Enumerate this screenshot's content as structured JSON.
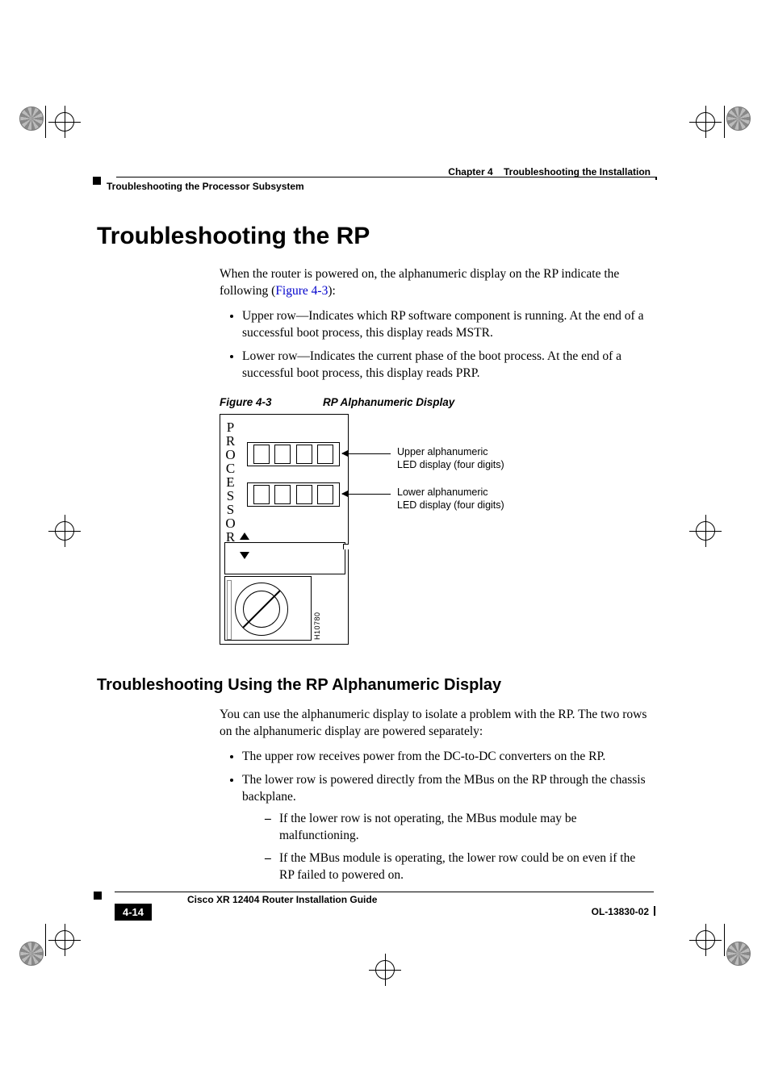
{
  "header": {
    "chapter": "Chapter 4",
    "chapter_title": "Troubleshooting the Installation",
    "section": "Troubleshooting the Processor Subsystem"
  },
  "h1": "Troubleshooting the RP",
  "intro": {
    "pre": "When the router is powered on, the alphanumeric display on the RP indicate the following (",
    "link": "Figure 4-3",
    "post": "):"
  },
  "bullets": [
    "Upper row—Indicates which RP software component is running. At the end of a successful boot process, this display reads MSTR.",
    "Lower row—Indicates the current phase of the boot process. At the end of a successful boot process, this display reads PRP."
  ],
  "figure": {
    "label": "Figure 4-3",
    "title": "RP Alphanumeric Display",
    "processor_label": "PROCESSOR",
    "callout_upper_l1": "Upper alphanumeric",
    "callout_upper_l2": "LED display (four digits)",
    "callout_lower_l1": "Lower alphanumeric",
    "callout_lower_l2": "LED display (four digits)",
    "id": "H10780"
  },
  "h2": "Troubleshooting Using the RP Alphanumeric Display",
  "para2": "You can use the alphanumeric display to isolate a problem with the RP. The two rows on the alphanumeric display are powered separately:",
  "bullets2": [
    "The upper row receives power from the DC-to-DC converters on the RP.",
    "The lower row is powered directly from the MBus on the RP through the chassis backplane."
  ],
  "dashes": [
    "If the lower row is not operating, the MBus module may be malfunctioning.",
    "If the MBus module is operating, the lower row could be on even if the RP failed to powered on."
  ],
  "footer": {
    "guide": "Cisco XR 12404 Router Installation Guide",
    "page": "4-14",
    "docid": "OL-13830-02"
  }
}
